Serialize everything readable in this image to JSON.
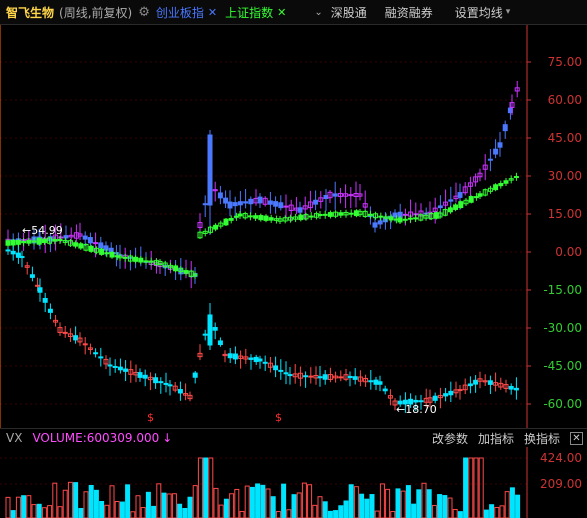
{
  "toolbar": {
    "stock_name": "智飞生物",
    "mode": "(周线,前复权)",
    "compare1": "创业板指",
    "compare2": "上证指数",
    "menu1": "深股通",
    "menu2": "融资融券",
    "menu3": "设置均线"
  },
  "price_axis": [
    "75.00",
    "60.00",
    "45.00",
    "30.00",
    "15.00",
    "0.00",
    "-15.00",
    "-30.00",
    "-45.00",
    "-60.00"
  ],
  "markers": {
    "high": "54.99",
    "low": "18.70"
  },
  "volume_panel": {
    "indicator": "VX",
    "label": "VOLUME:600309.000",
    "buttons": [
      "改参数",
      "加指标",
      "换指标"
    ],
    "axis": [
      "424.00",
      "209.00"
    ]
  },
  "colors": {
    "up": "#ff4a4a",
    "down": "#00e5ff",
    "compare1": "#4a78ff",
    "compare2": "#33ff33",
    "purple": "#cc33ff"
  }
}
